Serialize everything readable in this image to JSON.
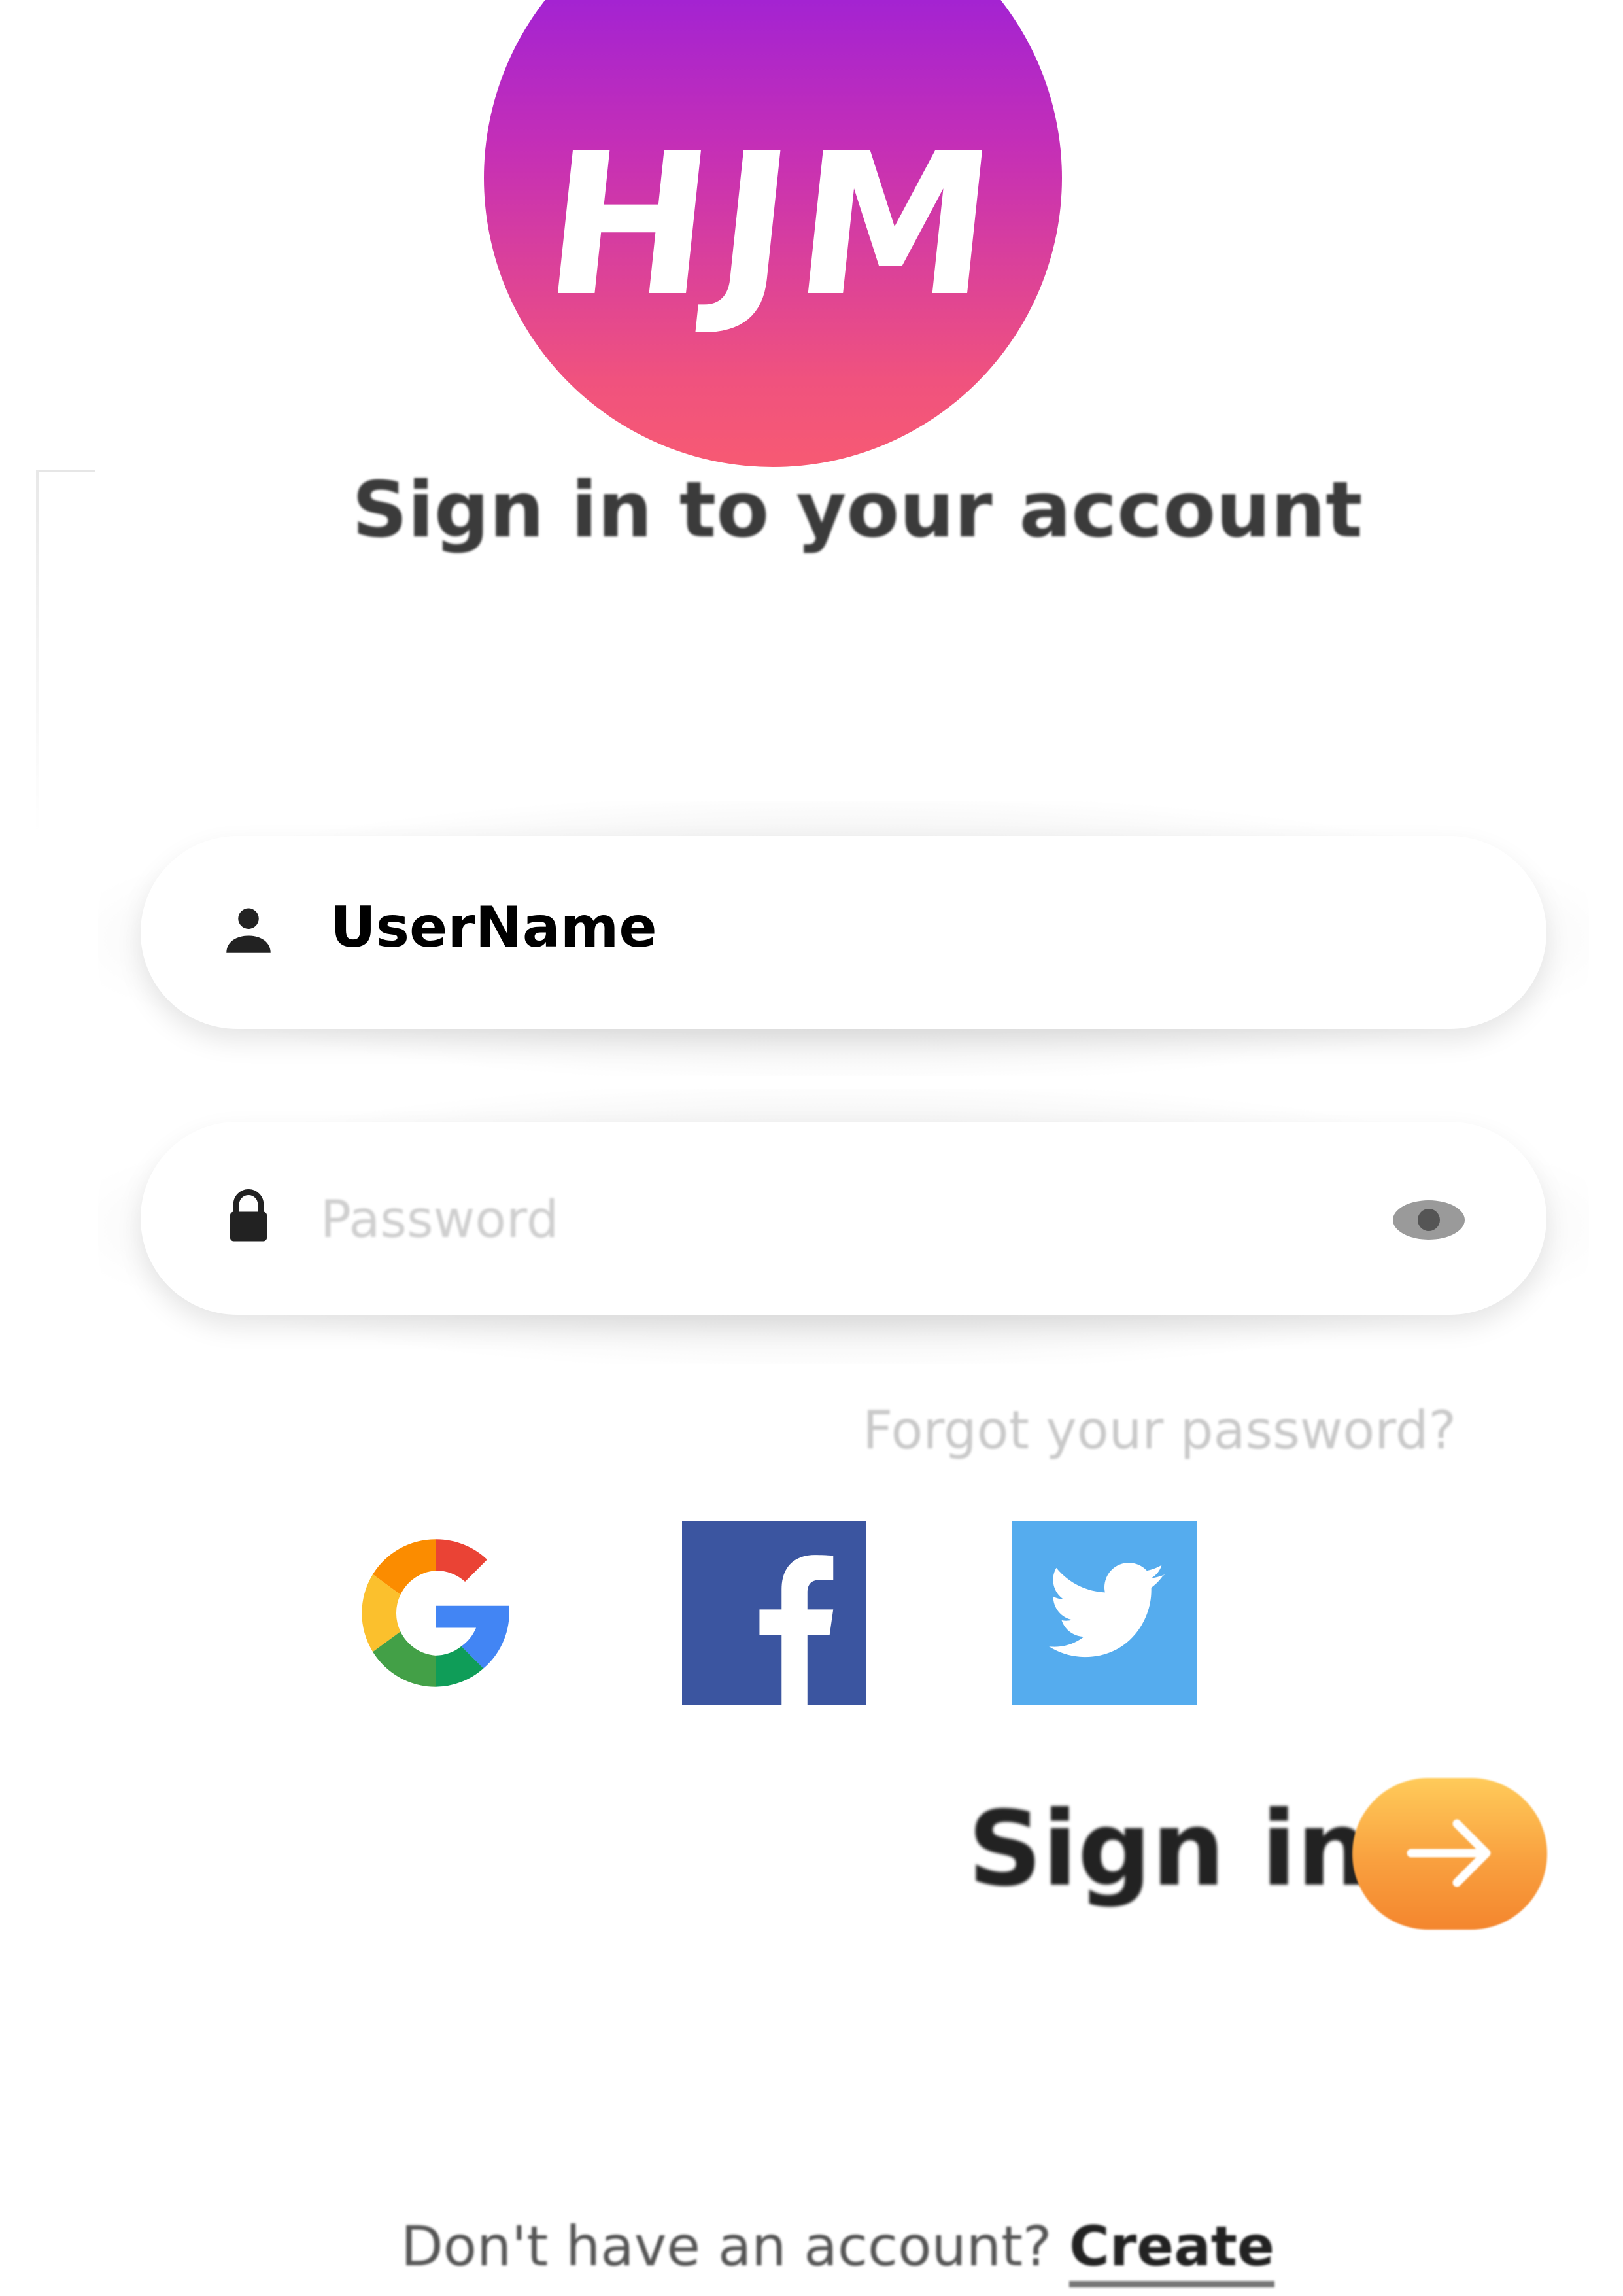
{
  "logo": {
    "text": "HJM",
    "icon": "hjm-logo"
  },
  "title": "Sign in to your account",
  "username_field": {
    "value": "UserName",
    "icon": "user-icon"
  },
  "password_field": {
    "placeholder": "Password",
    "icon": "lock-icon",
    "toggle_icon": "eye-icon"
  },
  "forgot_link": "Forgot your password?",
  "social": [
    {
      "name": "Google",
      "icon": "google-icon"
    },
    {
      "name": "Facebook",
      "icon": "facebook-icon",
      "color": "#3b55a0"
    },
    {
      "name": "Twitter",
      "icon": "twitter-icon",
      "color": "#55acee"
    }
  ],
  "signin": {
    "label": "Sign in",
    "icon": "arrow-right-icon"
  },
  "footer": {
    "text": "Don't have an account?",
    "link": "Create"
  }
}
